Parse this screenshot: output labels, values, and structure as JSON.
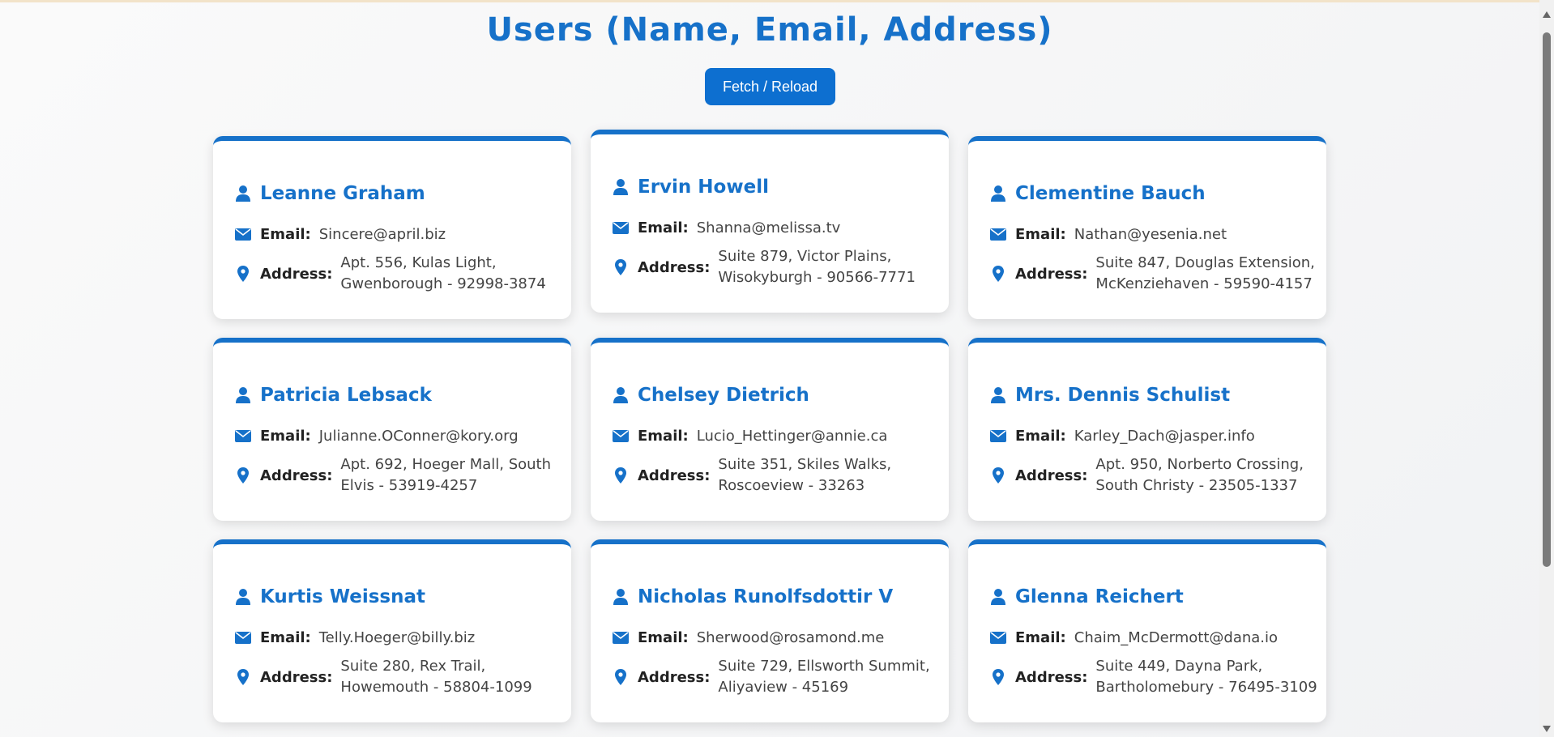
{
  "page": {
    "title": "Users (Name, Email, Address)"
  },
  "toolbar": {
    "fetch_label": "Fetch / Reload"
  },
  "labels": {
    "email": "Email:",
    "address": "Address:"
  },
  "colors": {
    "accent": "#1671c9",
    "button": "#0d6fd0"
  },
  "users": [
    {
      "name": "Leanne Graham",
      "email": "Sincere@april.biz",
      "address": "Apt. 556, Kulas Light, Gwenborough - 92998-3874"
    },
    {
      "name": "Ervin Howell",
      "email": "Shanna@melissa.tv",
      "address": "Suite 879, Victor Plains, Wisokyburgh - 90566-7771"
    },
    {
      "name": "Clementine Bauch",
      "email": "Nathan@yesenia.net",
      "address": "Suite 847, Douglas Extension, McKenziehaven - 59590-4157"
    },
    {
      "name": "Patricia Lebsack",
      "email": "Julianne.OConner@kory.org",
      "address": "Apt. 692, Hoeger Mall, South Elvis - 53919-4257"
    },
    {
      "name": "Chelsey Dietrich",
      "email": "Lucio_Hettinger@annie.ca",
      "address": "Suite 351, Skiles Walks, Roscoeview - 33263"
    },
    {
      "name": "Mrs. Dennis Schulist",
      "email": "Karley_Dach@jasper.info",
      "address": "Apt. 950, Norberto Crossing, South Christy - 23505-1337"
    },
    {
      "name": "Kurtis Weissnat",
      "email": "Telly.Hoeger@billy.biz",
      "address": "Suite 280, Rex Trail, Howemouth - 58804-1099"
    },
    {
      "name": "Nicholas Runolfsdottir V",
      "email": "Sherwood@rosamond.me",
      "address": "Suite 729, Ellsworth Summit, Aliyaview - 45169"
    },
    {
      "name": "Glenna Reichert",
      "email": "Chaim_McDermott@dana.io",
      "address": "Suite 449, Dayna Park, Bartholomebury - 76495-3109"
    }
  ],
  "icons": {
    "user": "person-icon",
    "email": "envelope-icon",
    "address": "map-pin-icon"
  }
}
